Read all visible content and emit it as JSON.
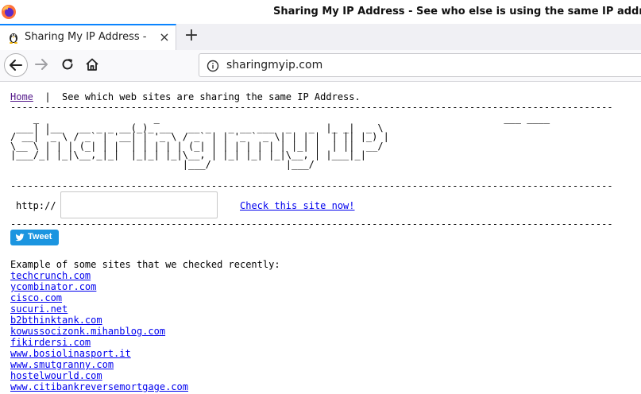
{
  "window": {
    "title": "Sharing My IP Address - See who else is using the same IP address f"
  },
  "tab": {
    "title": "Sharing My IP Address - S",
    "close_glyph": "×",
    "new_tab_glyph": "+"
  },
  "nav": {
    "url": "sharingmyip.com"
  },
  "page": {
    "home_label": "Home",
    "separator": "  |  ",
    "tagline": "See which web sites are sharing the same IP Address.",
    "dash_line": "---------------------------------------------------------------------------------------------------------",
    "ascii_art": "    _                    _                                                            ___ ____  \n ___| |__   __ _ _ __(_)_ __   __ _   _ __ ___  _   _  |_ _|  _ \\ \n/ __| '_ \\ / _` | '__| | '_ \\ / _` | | '_ ` _ \\| | | |  | || |_) |\n\\__ \\ | | | (_| | |  | | | | | (_| | | | | | | | |_| |  | ||  __/ \n|___/_| |_|\\__,_|_|  |_|_| |_|\\__, | |_| |_| |_|\\__, | |___|_|    \n                              |___/             |___/            ",
    "http_label": "http://",
    "input_value": "",
    "check_label": "Check this site now!",
    "tweet_label": "Tweet",
    "examples_title": "Example of some sites that we checked recently:",
    "sites": [
      "techcrunch.com",
      "ycombinator.com",
      "cisco.com",
      "sucuri.net",
      "b2bthinktank.com",
      "kowussocizonk.mihanblog.com",
      "fikirdersi.com",
      "www.bosiolinasport.it",
      "www.smutgranny.com",
      "hostelwourld.com",
      "www.citibankreversemortgage.com"
    ]
  },
  "colors": {
    "link": "#0000ee",
    "visited": "#551a8b",
    "tweet": "#1b95e0",
    "tab_accent": "#0a84ff"
  }
}
